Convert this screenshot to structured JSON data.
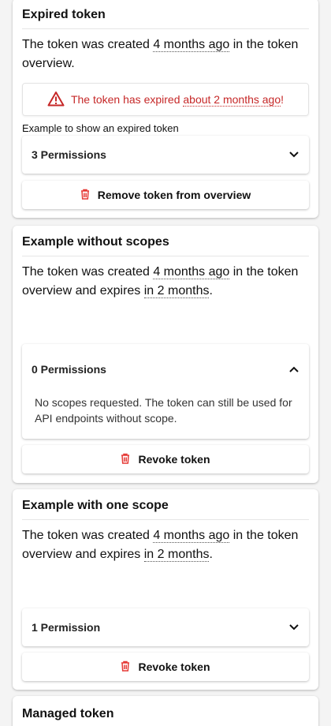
{
  "cards": {
    "expired": {
      "title": "Expired token",
      "desc_before": "The token was created ",
      "created_ago": "4 months ago",
      "desc_after": " in the token overview.",
      "alert_before": "The token has expired ",
      "alert_ago": "about 2 months ago",
      "alert_after": "!",
      "caption": "Example to show an expired token",
      "permissions_label": "3 Permissions",
      "action_label": "Remove token from overview"
    },
    "no_scopes": {
      "title": "Example without scopes",
      "desc_before": "The token was created ",
      "created_ago": "4 months ago",
      "desc_mid": " in the token overview and expires ",
      "expires_in": "in 2 months",
      "desc_after": ".",
      "permissions_label": "0 Permissions",
      "permissions_body": "No scopes requested. The token can still be used for API endpoints without scope.",
      "action_label": "Revoke token"
    },
    "one_scope": {
      "title": "Example with one scope",
      "desc_before": "The token was created ",
      "created_ago": "4 months ago",
      "desc_mid": " in the token overview and expires ",
      "expires_in": "in 2 months",
      "desc_after": ".",
      "permissions_label": "1 Permission",
      "action_label": "Revoke token"
    },
    "managed": {
      "title": "Managed token"
    }
  },
  "icons": {
    "warning": "warning-triangle-icon",
    "trash": "trash-icon",
    "chevron_down": "chevron-down-icon",
    "chevron_up": "chevron-up-icon"
  },
  "colors": {
    "danger": "#c62828",
    "trash_red": "#e53935"
  }
}
